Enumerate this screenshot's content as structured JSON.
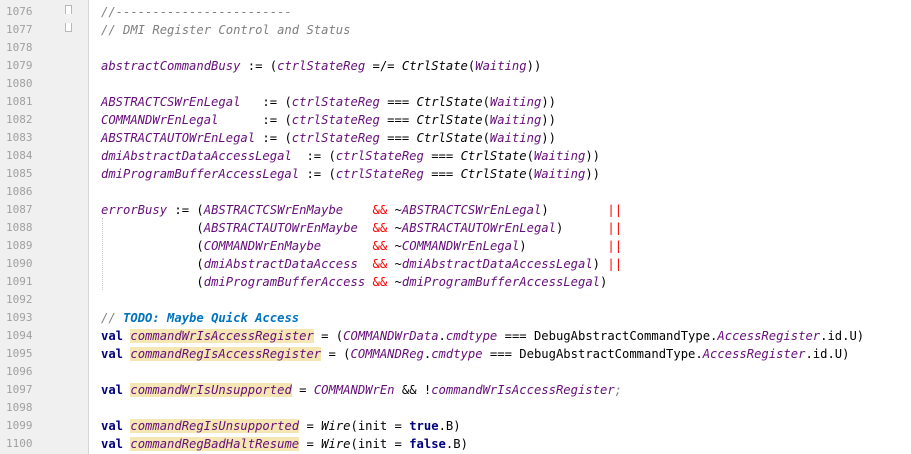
{
  "editor": {
    "lines": [
      {
        "n": "1076",
        "segs": [
          {
            "t": "//------------------------",
            "c": "comment"
          }
        ]
      },
      {
        "n": "1077",
        "segs": [
          {
            "t": "// DMI Register Control and Status",
            "c": "comment"
          }
        ]
      },
      {
        "n": "1078",
        "segs": []
      },
      {
        "n": "1079",
        "segs": [
          {
            "t": "abstractCommandBusy",
            "c": "field"
          },
          {
            "t": " := (",
            "c": "op"
          },
          {
            "t": "ctrlStateReg",
            "c": "field"
          },
          {
            "t": " =/= ",
            "c": "op"
          },
          {
            "t": "CtrlState",
            "c": "call"
          },
          {
            "t": "(",
            "c": "op"
          },
          {
            "t": "Waiting",
            "c": "field"
          },
          {
            "t": "))",
            "c": "op"
          }
        ]
      },
      {
        "n": "1080",
        "segs": []
      },
      {
        "n": "1081",
        "segs": [
          {
            "t": "ABSTRACTCSWrEnLegal",
            "c": "field"
          },
          {
            "t": "   := (",
            "c": "op"
          },
          {
            "t": "ctrlStateReg",
            "c": "field"
          },
          {
            "t": " === ",
            "c": "op"
          },
          {
            "t": "CtrlState",
            "c": "call"
          },
          {
            "t": "(",
            "c": "op"
          },
          {
            "t": "Waiting",
            "c": "field"
          },
          {
            "t": "))",
            "c": "op"
          }
        ]
      },
      {
        "n": "1082",
        "segs": [
          {
            "t": "COMMANDWrEnLegal",
            "c": "field"
          },
          {
            "t": "      := (",
            "c": "op"
          },
          {
            "t": "ctrlStateReg",
            "c": "field"
          },
          {
            "t": " === ",
            "c": "op"
          },
          {
            "t": "CtrlState",
            "c": "call"
          },
          {
            "t": "(",
            "c": "op"
          },
          {
            "t": "Waiting",
            "c": "field"
          },
          {
            "t": "))",
            "c": "op"
          }
        ]
      },
      {
        "n": "1083",
        "segs": [
          {
            "t": "ABSTRACTAUTOWrEnLegal",
            "c": "field"
          },
          {
            "t": " := (",
            "c": "op"
          },
          {
            "t": "ctrlStateReg",
            "c": "field"
          },
          {
            "t": " === ",
            "c": "op"
          },
          {
            "t": "CtrlState",
            "c": "call"
          },
          {
            "t": "(",
            "c": "op"
          },
          {
            "t": "Waiting",
            "c": "field"
          },
          {
            "t": "))",
            "c": "op"
          }
        ]
      },
      {
        "n": "1084",
        "segs": [
          {
            "t": "dmiAbstractDataAccessLegal",
            "c": "field"
          },
          {
            "t": "  := (",
            "c": "op"
          },
          {
            "t": "ctrlStateReg",
            "c": "field"
          },
          {
            "t": " === ",
            "c": "op"
          },
          {
            "t": "CtrlState",
            "c": "call"
          },
          {
            "t": "(",
            "c": "op"
          },
          {
            "t": "Waiting",
            "c": "field"
          },
          {
            "t": "))",
            "c": "op"
          }
        ]
      },
      {
        "n": "1085",
        "segs": [
          {
            "t": "dmiProgramBufferAccessLegal",
            "c": "field"
          },
          {
            "t": " := (",
            "c": "op"
          },
          {
            "t": "ctrlStateReg",
            "c": "field"
          },
          {
            "t": " === ",
            "c": "op"
          },
          {
            "t": "CtrlState",
            "c": "call"
          },
          {
            "t": "(",
            "c": "op"
          },
          {
            "t": "Waiting",
            "c": "field"
          },
          {
            "t": "))",
            "c": "op"
          }
        ]
      },
      {
        "n": "1086",
        "segs": []
      },
      {
        "n": "1087",
        "segs": [
          {
            "t": "errorBusy",
            "c": "field"
          },
          {
            "t": " := (",
            "c": "op"
          },
          {
            "t": "ABSTRACTCSWrEnMaybe",
            "c": "field"
          },
          {
            "t": "    ",
            "c": "op"
          },
          {
            "t": "&&",
            "c": "red"
          },
          {
            "t": " ~",
            "c": "op"
          },
          {
            "t": "ABSTRACTCSWrEnLegal",
            "c": "field"
          },
          {
            "t": ")        ",
            "c": "op"
          },
          {
            "t": "||",
            "c": "red"
          }
        ]
      },
      {
        "n": "1088",
        "segs": [
          {
            "t": "             (",
            "c": "op"
          },
          {
            "t": "ABSTRACTAUTOWrEnMaybe",
            "c": "field"
          },
          {
            "t": "  ",
            "c": "op"
          },
          {
            "t": "&&",
            "c": "red"
          },
          {
            "t": " ~",
            "c": "op"
          },
          {
            "t": "ABSTRACTAUTOWrEnLegal",
            "c": "field"
          },
          {
            "t": ")      ",
            "c": "op"
          },
          {
            "t": "||",
            "c": "red"
          }
        ]
      },
      {
        "n": "1089",
        "segs": [
          {
            "t": "             (",
            "c": "op"
          },
          {
            "t": "COMMANDWrEnMaybe",
            "c": "field"
          },
          {
            "t": "       ",
            "c": "op"
          },
          {
            "t": "&&",
            "c": "red"
          },
          {
            "t": " ~",
            "c": "op"
          },
          {
            "t": "COMMANDWrEnLegal",
            "c": "field"
          },
          {
            "t": ")           ",
            "c": "op"
          },
          {
            "t": "||",
            "c": "red"
          }
        ]
      },
      {
        "n": "1090",
        "segs": [
          {
            "t": "             (",
            "c": "op"
          },
          {
            "t": "dmiAbstractDataAccess",
            "c": "field"
          },
          {
            "t": "  ",
            "c": "op"
          },
          {
            "t": "&&",
            "c": "red"
          },
          {
            "t": " ~",
            "c": "op"
          },
          {
            "t": "dmiAbstractDataAccessLegal",
            "c": "field"
          },
          {
            "t": ") ",
            "c": "op"
          },
          {
            "t": "||",
            "c": "red"
          }
        ]
      },
      {
        "n": "1091",
        "segs": [
          {
            "t": "             (",
            "c": "op"
          },
          {
            "t": "dmiProgramBufferAccess",
            "c": "field"
          },
          {
            "t": " ",
            "c": "op"
          },
          {
            "t": "&&",
            "c": "red"
          },
          {
            "t": " ~",
            "c": "op"
          },
          {
            "t": "dmiProgramBufferAccessLegal",
            "c": "field"
          },
          {
            "t": ")",
            "c": "op"
          }
        ]
      },
      {
        "n": "1092",
        "segs": []
      },
      {
        "n": "1093",
        "segs": [
          {
            "t": "// ",
            "c": "comment"
          },
          {
            "t": "TODO: Maybe Quick Access",
            "c": "todo"
          }
        ]
      },
      {
        "n": "1094",
        "segs": [
          {
            "t": "val",
            "c": "kw"
          },
          {
            "t": " ",
            "c": "plain"
          },
          {
            "t": "commandWrIsAccessRegister",
            "c": "hl"
          },
          {
            "t": " = (",
            "c": "op"
          },
          {
            "t": "COMMANDWrData",
            "c": "field"
          },
          {
            "t": ".",
            "c": "op"
          },
          {
            "t": "cmdtype",
            "c": "field"
          },
          {
            "t": " === DebugAbstractCommandType.",
            "c": "plain"
          },
          {
            "t": "AccessRegister",
            "c": "field"
          },
          {
            "t": ".id.U)",
            "c": "plain"
          }
        ]
      },
      {
        "n": "1095",
        "segs": [
          {
            "t": "val",
            "c": "kw"
          },
          {
            "t": " ",
            "c": "plain"
          },
          {
            "t": "commandRegIsAccessRegister",
            "c": "hl"
          },
          {
            "t": " = (",
            "c": "op"
          },
          {
            "t": "COMMANDReg",
            "c": "field"
          },
          {
            "t": ".",
            "c": "op"
          },
          {
            "t": "cmdtype",
            "c": "field"
          },
          {
            "t": " === DebugAbstractCommandType.",
            "c": "plain"
          },
          {
            "t": "AccessRegister",
            "c": "field"
          },
          {
            "t": ".id.U)",
            "c": "plain"
          }
        ]
      },
      {
        "n": "1096",
        "segs": []
      },
      {
        "n": "1097",
        "segs": [
          {
            "t": "val",
            "c": "kw"
          },
          {
            "t": " ",
            "c": "plain"
          },
          {
            "t": "commandWrIsUnsupported",
            "c": "hl"
          },
          {
            "t": " = ",
            "c": "op"
          },
          {
            "t": "COMMANDWrEn",
            "c": "field"
          },
          {
            "t": " && !",
            "c": "op"
          },
          {
            "t": "commandWrIsAccessRegister",
            "c": "field"
          },
          {
            "t": ";",
            "c": "comment"
          }
        ]
      },
      {
        "n": "1098",
        "segs": []
      },
      {
        "n": "1099",
        "segs": [
          {
            "t": "val",
            "c": "kw"
          },
          {
            "t": " ",
            "c": "plain"
          },
          {
            "t": "commandRegIsUnsupported",
            "c": "hl"
          },
          {
            "t": " = ",
            "c": "op"
          },
          {
            "t": "Wire",
            "c": "call"
          },
          {
            "t": "(init = ",
            "c": "plain"
          },
          {
            "t": "true",
            "c": "kw"
          },
          {
            "t": ".B)",
            "c": "plain"
          }
        ]
      },
      {
        "n": "1100",
        "segs": [
          {
            "t": "val",
            "c": "kw"
          },
          {
            "t": " ",
            "c": "plain"
          },
          {
            "t": "commandRegBadHaltResume",
            "c": "hl"
          },
          {
            "t": " = ",
            "c": "op"
          },
          {
            "t": "Wire",
            "c": "call"
          },
          {
            "t": "(init = ",
            "c": "plain"
          },
          {
            "t": "false",
            "c": "kw"
          },
          {
            "t": ".B)",
            "c": "plain"
          }
        ]
      }
    ]
  }
}
